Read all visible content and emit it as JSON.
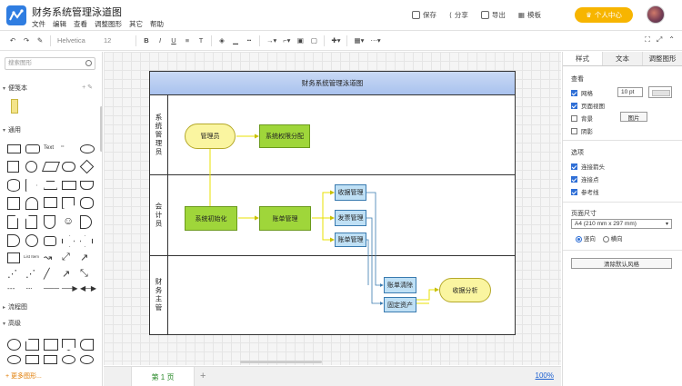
{
  "app": {
    "title": "财务系统管理泳道图"
  },
  "menu": [
    "文件",
    "编辑",
    "查看",
    "调整图形",
    "其它",
    "帮助"
  ],
  "top_actions": {
    "save": "保存",
    "share": "分享",
    "export": "导出",
    "template": "模板"
  },
  "vip_button": "个人中心",
  "toolbar": {
    "font": "Helvetica",
    "size": "12",
    "bold": "B",
    "italic": "I",
    "underline": "U",
    "align": "≡",
    "text": "T"
  },
  "left_panel": {
    "search_placeholder": "搜索图形",
    "sections": {
      "notes": "便笺本",
      "general": "通用",
      "flowchart": "流程图",
      "advanced": "高级"
    },
    "more": "+ 更多图形..."
  },
  "diagram": {
    "pool_title": "财务系统管理泳道图",
    "lanes": [
      "系统管理员",
      "会计员",
      "财务主管"
    ],
    "nodes": {
      "admin": "管理员",
      "permission": "系统权限分配",
      "init": "系统初始化",
      "ledger": "账单管理",
      "receipt": "收据管理",
      "invoice": "发票管理",
      "bill": "账单管理",
      "clear": "账单清除",
      "asset": "固定资产",
      "analysis": "收据分析"
    }
  },
  "page_tab": "第 1 页",
  "zoom": "100%",
  "right_panel": {
    "tabs": [
      "样式",
      "文本",
      "调整图形"
    ],
    "view_heading": "查看",
    "grid": "网格",
    "grid_size": "10 pt",
    "page_view": "页面视图",
    "background": "背景",
    "image_button": "图片",
    "shadow": "阴影",
    "options_heading": "选项",
    "connection_arrows": "连接箭头",
    "connection_points": "连接点",
    "guides": "参考线",
    "paper_heading": "页面尺寸",
    "paper_value": "A4 (210 mm x 297 mm)",
    "portrait": "竖向",
    "landscape": "横向",
    "reset_button": "清除默认风格"
  },
  "colors": {
    "accent": "#2f7de1",
    "vip": "#f7b500",
    "node_green": "#9fd63a",
    "node_blue": "#bfe0f5",
    "node_yellow": "#faf5a0",
    "connector": "#e8e000",
    "pool_head": "#b8cdf2"
  }
}
